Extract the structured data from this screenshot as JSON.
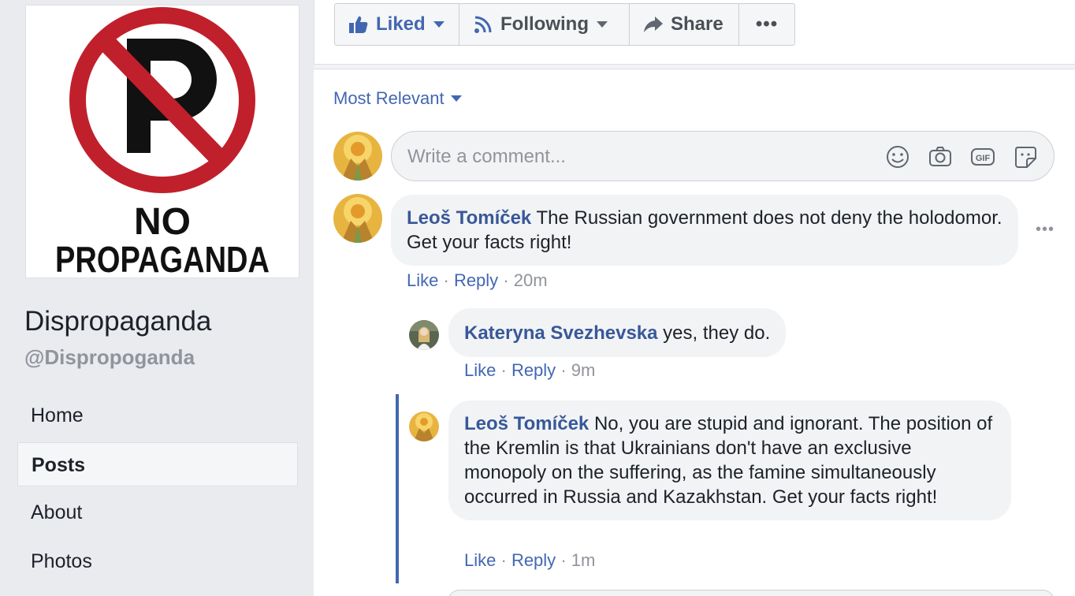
{
  "page": {
    "name": "Dispropaganda",
    "handle": "@Dispropoganda",
    "logo_text_line1": "NO",
    "logo_text_line2": "PROPAGANDA"
  },
  "nav": {
    "items": [
      {
        "label": "Home",
        "active": false
      },
      {
        "label": "Posts",
        "active": true
      },
      {
        "label": "About",
        "active": false
      },
      {
        "label": "Photos",
        "active": false
      }
    ]
  },
  "actions": {
    "liked": "Liked",
    "following": "Following",
    "share": "Share",
    "more": "•••"
  },
  "sort": {
    "label": "Most Relevant"
  },
  "composer": {
    "placeholder": "Write a comment...",
    "icons": [
      "emoji-icon",
      "camera-icon",
      "gif-icon",
      "sticker-icon"
    ]
  },
  "comments": [
    {
      "author": "Leoš Tomíček",
      "text": "The Russian government does not deny the holodomor. Get your facts right!",
      "like": "Like",
      "reply": "Reply",
      "time": "20m",
      "more": "•••"
    },
    {
      "author": "Kateryna Svezhevska",
      "text": "yes, they do.",
      "like": "Like",
      "reply": "Reply",
      "time": "9m"
    },
    {
      "author": "Leoš Tomíček",
      "text": "No, you are stupid and ignorant. The position of the Kremlin is that Ukrainians don't have an exclusive monopoly on the suffering, as the famine simultaneously occurred in Russia and Kazakhstan. Get your facts right!",
      "like": "Like",
      "reply": "Reply",
      "time": "1m"
    }
  ],
  "separator": "·",
  "colors": {
    "link": "#4267b2",
    "author": "#385898",
    "bubble": "#f2f3f5",
    "sign_red": "#c0202c"
  }
}
